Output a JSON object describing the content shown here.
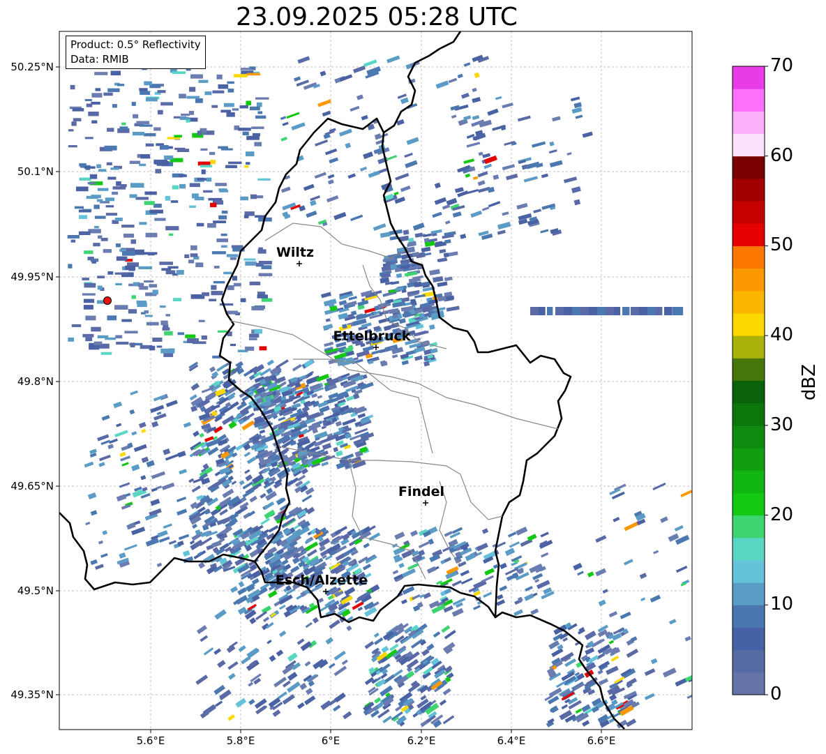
{
  "title": "23.09.2025 05:28 UTC",
  "info": {
    "product_line": "Product: 0.5° Reflectivity",
    "data_line": "Data: RMIB"
  },
  "lat_ticks": [
    "50.25°N",
    "50.1°N",
    "49.95°N",
    "49.8°N",
    "49.65°N",
    "49.5°N",
    "49.35°N"
  ],
  "lon_ticks": [
    "5.6°E",
    "5.8°E",
    "6°E",
    "6.2°E",
    "6.4°E",
    "6.6°E"
  ],
  "cities": [
    {
      "name": "Wiltz"
    },
    {
      "name": "Ettelbruck"
    },
    {
      "name": "Findel"
    },
    {
      "name": "Esch/Alzette"
    }
  ],
  "colorbar": {
    "label": "dBZ",
    "ticks": [
      "70",
      "60",
      "50",
      "40",
      "30",
      "20",
      "10",
      "0"
    ],
    "colors": [
      "#6474a8",
      "#566aa3",
      "#4662a6",
      "#4a76b0",
      "#5a9cc6",
      "#64c2da",
      "#5ad6c4",
      "#3ed470",
      "#12c812",
      "#12b612",
      "#109e10",
      "#0e8a0e",
      "#0c760c",
      "#0a620a",
      "#46760a",
      "#a8b20a",
      "#fcd800",
      "#fcb600",
      "#fc9800",
      "#fc7800",
      "#e40000",
      "#c60000",
      "#a20000",
      "#7a0000",
      "#fde0fc",
      "#fcb0fc",
      "#fc70fc",
      "#e83ce8"
    ]
  }
}
